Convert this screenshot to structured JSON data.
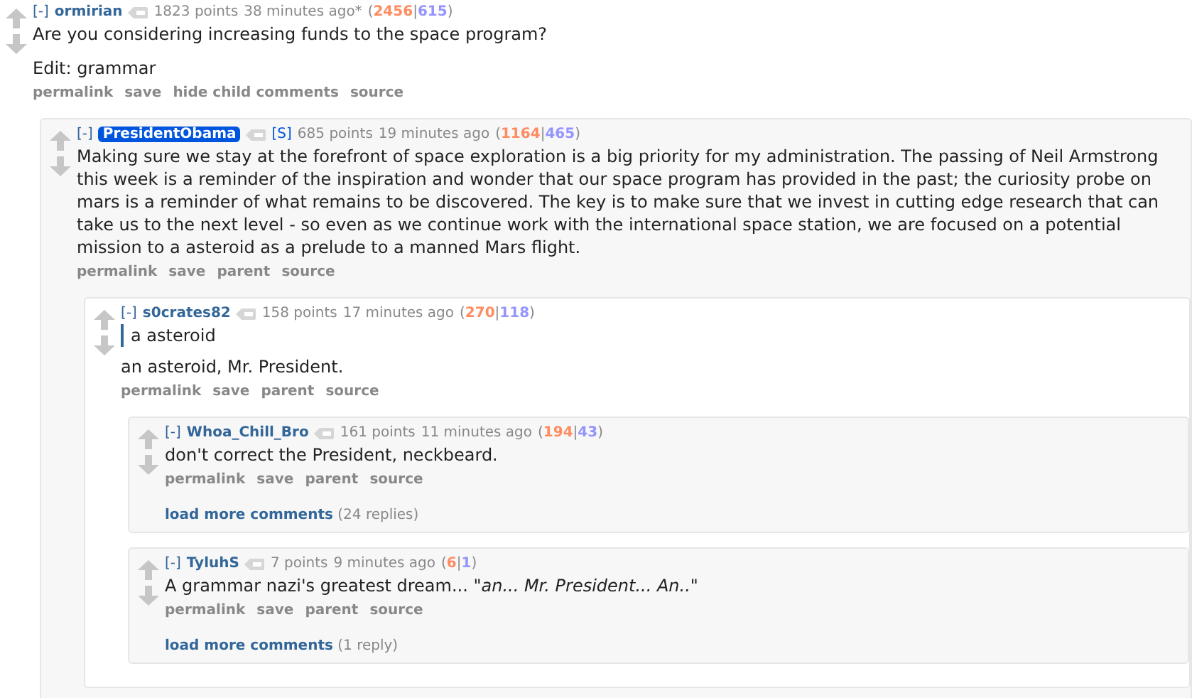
{
  "comments": [
    {
      "toggle": "[-]",
      "author": "ormirian",
      "highlighted": false,
      "points": "1823 points",
      "time": "38 minutes ago*",
      "breakdown": {
        "open": "(",
        "ups": "2456",
        "sep": "|",
        "downs": "615",
        "close": ")"
      },
      "body": [
        {
          "kind": "text",
          "text": "Are you considering increasing funds to the space program?"
        },
        {
          "kind": "text",
          "text": "Edit: grammar"
        }
      ],
      "actions": [
        "permalink",
        "save",
        "hide child comments",
        "source"
      ],
      "children": [
        {
          "toggle": "[-]",
          "author": "PresidentObama",
          "highlighted": true,
          "tag": "[S]",
          "points": "685 points",
          "time": "19 minutes ago",
          "breakdown": {
            "open": "(",
            "ups": "1164",
            "sep": "|",
            "downs": "465",
            "close": ")"
          },
          "body": [
            {
              "kind": "text",
              "text": "Making sure we stay at the forefront of space exploration is a big priority for my administration. The passing of Neil Armstrong this week is a reminder of the inspiration and wonder that our space program has provided in the past; the curiosity probe on mars is a reminder of what remains to be discovered. The key is to make sure that we invest in cutting edge research that can take us to the next level - so even as we continue work with the international space station, we are focused on a potential mission to a asteroid as a prelude to a manned Mars flight."
            }
          ],
          "actions": [
            "permalink",
            "save",
            "parent",
            "source"
          ],
          "children": [
            {
              "toggle": "[-]",
              "author": "s0crates82",
              "highlighted": false,
              "points": "158 points",
              "time": "17 minutes ago",
              "breakdown": {
                "open": "(",
                "ups": "270",
                "sep": "|",
                "downs": "118",
                "close": ")"
              },
              "body": [
                {
                  "kind": "quote",
                  "text": "a asteroid"
                },
                {
                  "kind": "text",
                  "text": "an asteroid, Mr. President."
                }
              ],
              "actions": [
                "permalink",
                "save",
                "parent",
                "source"
              ],
              "children": [
                {
                  "toggle": "[-]",
                  "author": "Whoa_Chill_Bro",
                  "highlighted": false,
                  "points": "161 points",
                  "time": "11 minutes ago",
                  "breakdown": {
                    "open": "(",
                    "ups": "194",
                    "sep": "|",
                    "downs": "43",
                    "close": ")"
                  },
                  "body": [
                    {
                      "kind": "text",
                      "text": "don't correct the President, neckbeard."
                    }
                  ],
                  "actions": [
                    "permalink",
                    "save",
                    "parent",
                    "source"
                  ],
                  "load_more": {
                    "label": "load more comments",
                    "count": "(24 replies)"
                  }
                },
                {
                  "toggle": "[-]",
                  "author": "TyluhS",
                  "highlighted": false,
                  "points": "7 points",
                  "time": "9 minutes ago",
                  "breakdown": {
                    "open": "(",
                    "ups": "6",
                    "sep": "|",
                    "downs": "1",
                    "close": ")"
                  },
                  "body": [
                    {
                      "kind": "text",
                      "text": "A grammar nazi's greatest dream... *\"an... Mr. President... An..\"*"
                    }
                  ],
                  "actions": [
                    "permalink",
                    "save",
                    "parent",
                    "source"
                  ],
                  "load_more": {
                    "label": "load more comments",
                    "count": "(1 reply)"
                  }
                }
              ]
            }
          ]
        }
      ]
    }
  ]
}
